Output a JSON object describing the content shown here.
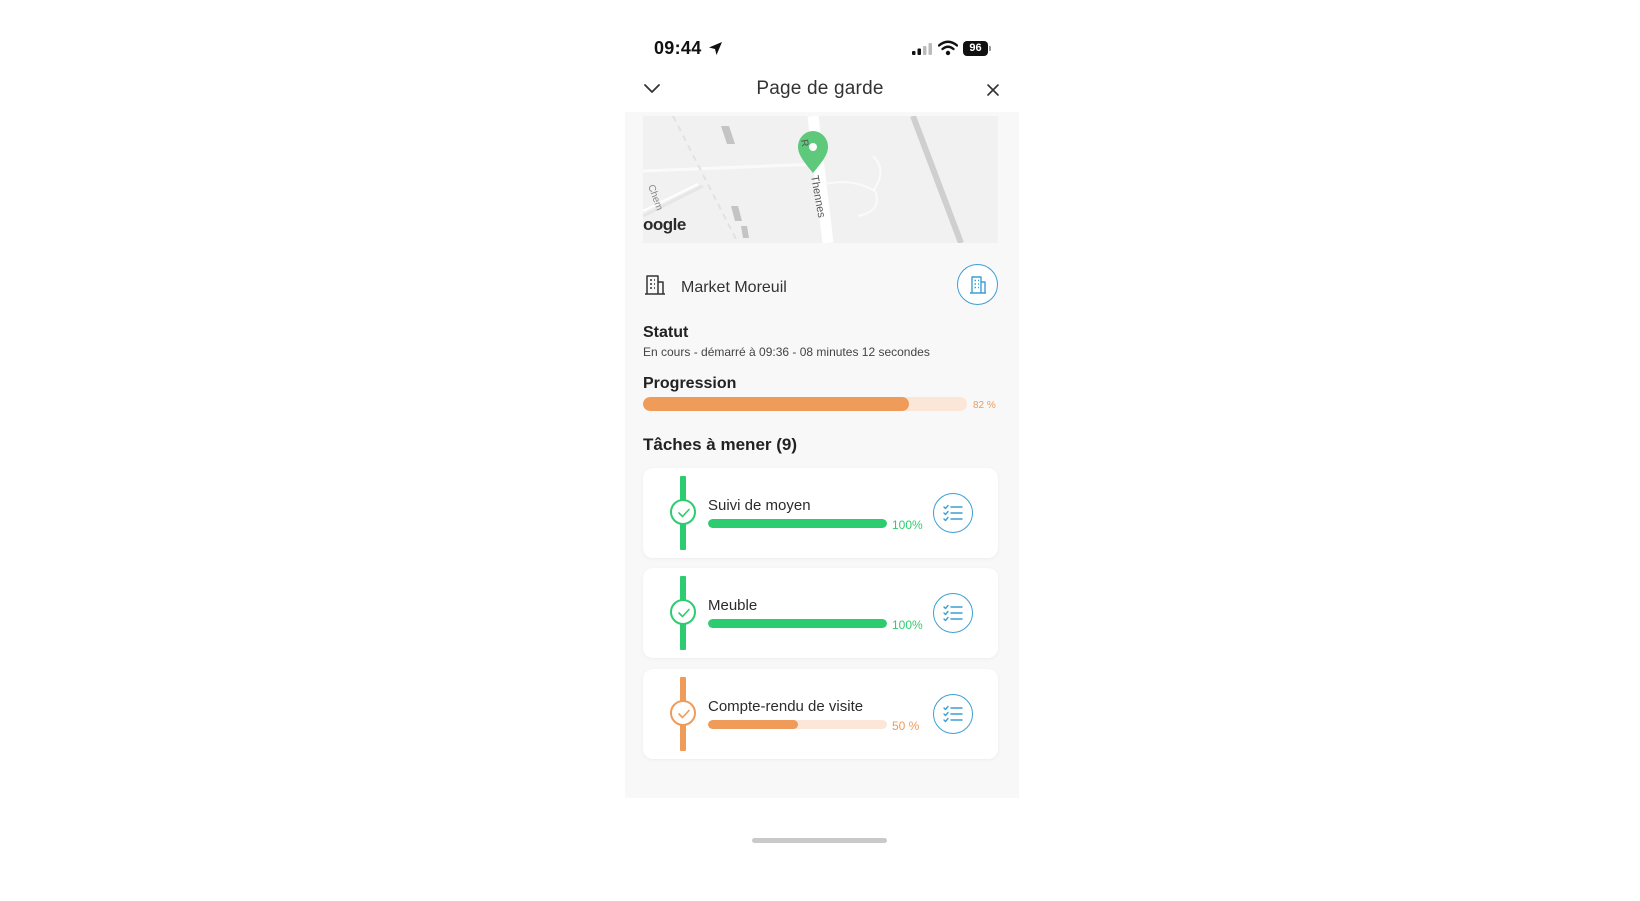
{
  "status_bar": {
    "time": "09:44",
    "battery": "96"
  },
  "header": {
    "title": "Page de garde"
  },
  "map": {
    "street_label": "Thennes",
    "side_label": "Chem",
    "logo_text": "oogle"
  },
  "site": {
    "name": "Market Moreuil"
  },
  "statut": {
    "label": "Statut",
    "text": "En cours - démarré à 09:36 - 08 minutes 12 secondes"
  },
  "progression": {
    "label": "Progression",
    "value": 82,
    "text": "82 %",
    "color": "#ef9b5a",
    "track_color": "#fbe6d8"
  },
  "tasks": {
    "title": "Tâches à mener (9)",
    "items": [
      {
        "name": "Suivi de moyen",
        "value": 100,
        "pct_text": "100%",
        "color": "#2ecc71",
        "track_color": "#d6f5e3"
      },
      {
        "name": "Meuble",
        "value": 100,
        "pct_text": "100%",
        "color": "#2ecc71",
        "track_color": "#d6f5e3"
      },
      {
        "name": "Compte-rendu de visite",
        "value": 50,
        "pct_text": "50 %",
        "color": "#ef9b5a",
        "track_color": "#fbe6d8"
      }
    ]
  },
  "colors": {
    "accent_blue": "#3d9fd4",
    "map_pin": "#5ec97a"
  }
}
